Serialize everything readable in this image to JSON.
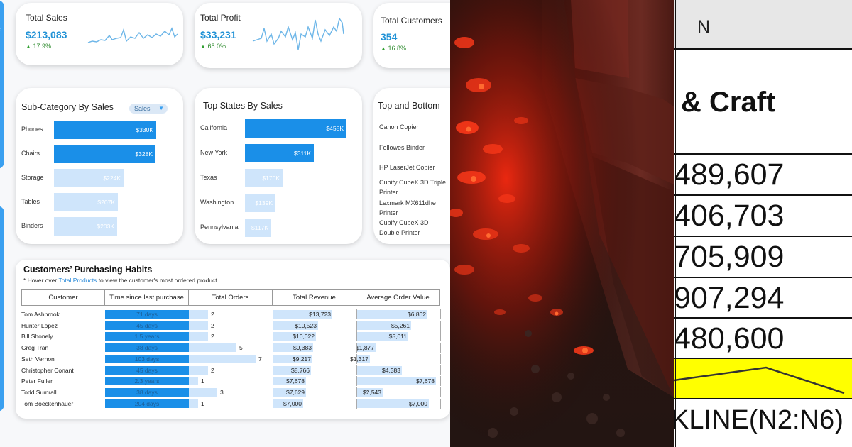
{
  "kpis": [
    {
      "title": "Total Sales",
      "value": "$213,083",
      "growth": "17.9%"
    },
    {
      "title": "Total Profit",
      "value": "$33,231",
      "growth": "65.0%"
    },
    {
      "title": "Total Customers",
      "value": "354",
      "growth": "16.8%"
    }
  ],
  "subcategory": {
    "title": "Sub-Category By Sales",
    "filter": "Sales",
    "rows": [
      {
        "label": "Phones",
        "value": "$330K",
        "num": 330
      },
      {
        "label": "Chairs",
        "value": "$328K",
        "num": 328
      },
      {
        "label": "Storage",
        "value": "$224K",
        "num": 224
      },
      {
        "label": "Tables",
        "value": "$207K",
        "num": 207
      },
      {
        "label": "Binders",
        "value": "$203K",
        "num": 203
      }
    ]
  },
  "states": {
    "title": "Top States By Sales",
    "rows": [
      {
        "label": "California",
        "value": "$458K",
        "num": 458
      },
      {
        "label": "New York",
        "value": "$311K",
        "num": 311
      },
      {
        "label": "Texas",
        "value": "$170K",
        "num": 170
      },
      {
        "label": "Washington",
        "value": "$139K",
        "num": 139
      },
      {
        "label": "Pennsylvania",
        "value": "$117K",
        "num": 117
      }
    ]
  },
  "topbottom": {
    "title": "Top and Bottom",
    "items": [
      "Canon Copier",
      "Fellowes Binder",
      "HP LaserJet Copier",
      "Cubify CubeX 3D Triple Printer",
      "Lexmark MX611dhe Printer",
      "Cubify CubeX 3D Double Printer"
    ]
  },
  "habits": {
    "title": "Customers’ Purchasing Habits",
    "sub_prefix": "* Hover over ",
    "sub_link": "Total Products",
    "sub_suffix": " to view the customer's most ordered product",
    "columns": [
      "Customer",
      "Time since last purchase",
      "Total Orders",
      "Total Revenue",
      "Average Order Value"
    ],
    "rows": [
      {
        "customer": "Tom Ashbrook",
        "time": "71 days",
        "orders": "2",
        "orders_n": 2,
        "revenue": "$13,723",
        "rev_n": 13723,
        "aov": "$6,862",
        "aov_n": 6862
      },
      {
        "customer": "Hunter Lopez",
        "time": "45 days",
        "orders": "2",
        "orders_n": 2,
        "revenue": "$10,523",
        "rev_n": 10523,
        "aov": "$5,261",
        "aov_n": 5261
      },
      {
        "customer": "Bill Shonely",
        "time": "1.5 years",
        "orders": "2",
        "orders_n": 2,
        "revenue": "$10,022",
        "rev_n": 10022,
        "aov": "$5,011",
        "aov_n": 5011
      },
      {
        "customer": "Greg Tran",
        "time": "38 days",
        "orders": "5",
        "orders_n": 5,
        "revenue": "$9,383",
        "rev_n": 9383,
        "aov": "$1,877",
        "aov_n": 1877
      },
      {
        "customer": "Seth Vernon",
        "time": "103 days",
        "orders": "7",
        "orders_n": 7,
        "revenue": "$9,217",
        "rev_n": 9217,
        "aov": "$1,317",
        "aov_n": 1317
      },
      {
        "customer": "Christopher Conant",
        "time": "45 days",
        "orders": "2",
        "orders_n": 2,
        "revenue": "$8,766",
        "rev_n": 8766,
        "aov": "$4,383",
        "aov_n": 4383
      },
      {
        "customer": "Peter Fuller",
        "time": "2.3 years",
        "orders": "1",
        "orders_n": 1,
        "revenue": "$7,678",
        "rev_n": 7678,
        "aov": "$7,678",
        "aov_n": 7678
      },
      {
        "customer": "Todd Sumrall",
        "time": "38 days",
        "orders": "3",
        "orders_n": 3,
        "revenue": "$7,629",
        "rev_n": 7629,
        "aov": "$2,543",
        "aov_n": 2543
      },
      {
        "customer": "Tom Boeckenhauer",
        "time": "204 days",
        "orders": "1",
        "orders_n": 1,
        "revenue": "$7,000",
        "rev_n": 7000,
        "aov": "$7,000",
        "aov_n": 7000
      }
    ]
  },
  "spreadsheet": {
    "column_header": "N",
    "category": "& Craft",
    "values": [
      "489,607",
      "406,703",
      "705,909",
      "907,294",
      "480,600"
    ],
    "formula": "KLINE(N2:N6)",
    "sparkline_color": "#ffff00"
  },
  "colors": {
    "accent": "#2192d6",
    "bar_dark": "#1a8fe8",
    "bar_light": "#cfe5fb",
    "growth": "#2e8b2e",
    "sparkline": "#6db6e8"
  }
}
